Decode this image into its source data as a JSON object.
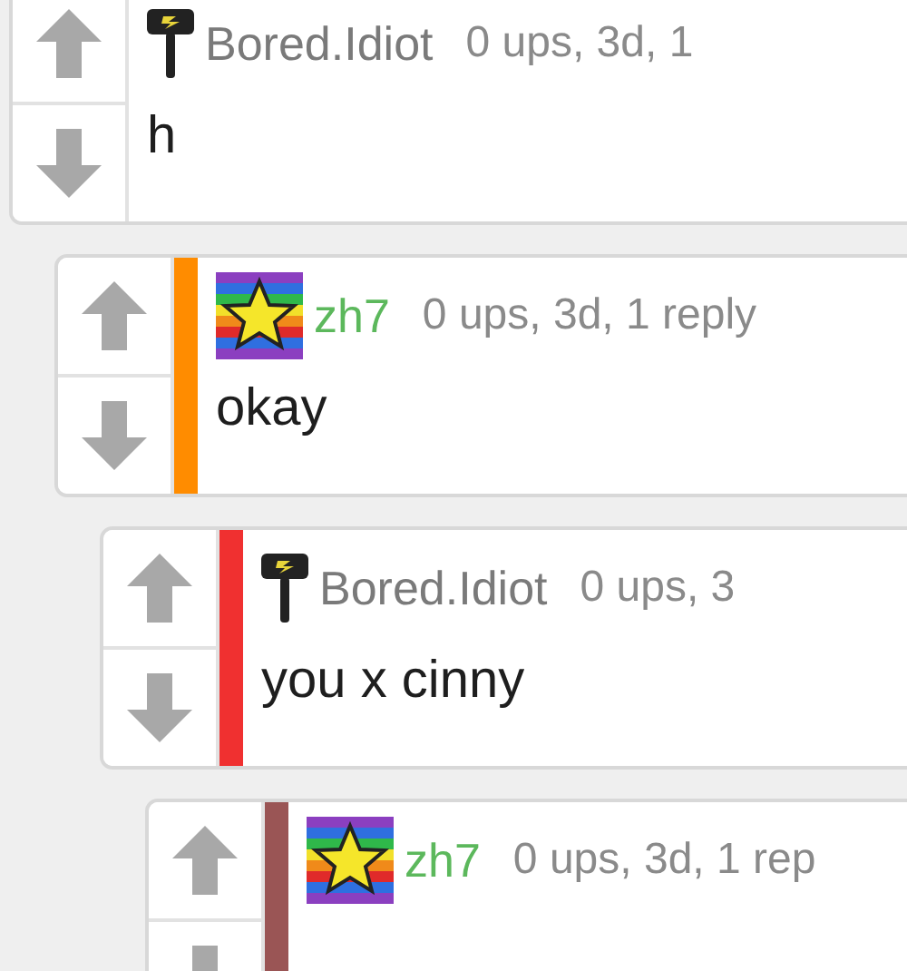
{
  "comments": [
    {
      "kind": "hammer",
      "user": {
        "name": "Bored.Idiot",
        "color": "#7a7a7a"
      },
      "meta": "0 ups, 3d, 1",
      "text": "h",
      "children": [
        {
          "kind": "star",
          "user": {
            "name": "zh7",
            "color": "#5cb85c"
          },
          "meta": "0 ups, 3d, 1 reply",
          "text": "okay",
          "bar": {
            "color": "#ff8c00"
          },
          "children": [
            {
              "kind": "hammer",
              "user": {
                "name": "Bored.Idiot",
                "color": "#7a7a7a"
              },
              "meta": "0 ups, 3",
              "text": "you x cinny",
              "bar": {
                "color": "#f03030"
              },
              "children": [
                {
                  "kind": "star",
                  "user": {
                    "name": "zh7",
                    "color": "#5cb85c"
                  },
                  "meta": "0 ups, 3d, 1 rep",
                  "bar": {
                    "color": "#9a5555"
                  }
                }
              ]
            }
          ]
        }
      ]
    }
  ]
}
